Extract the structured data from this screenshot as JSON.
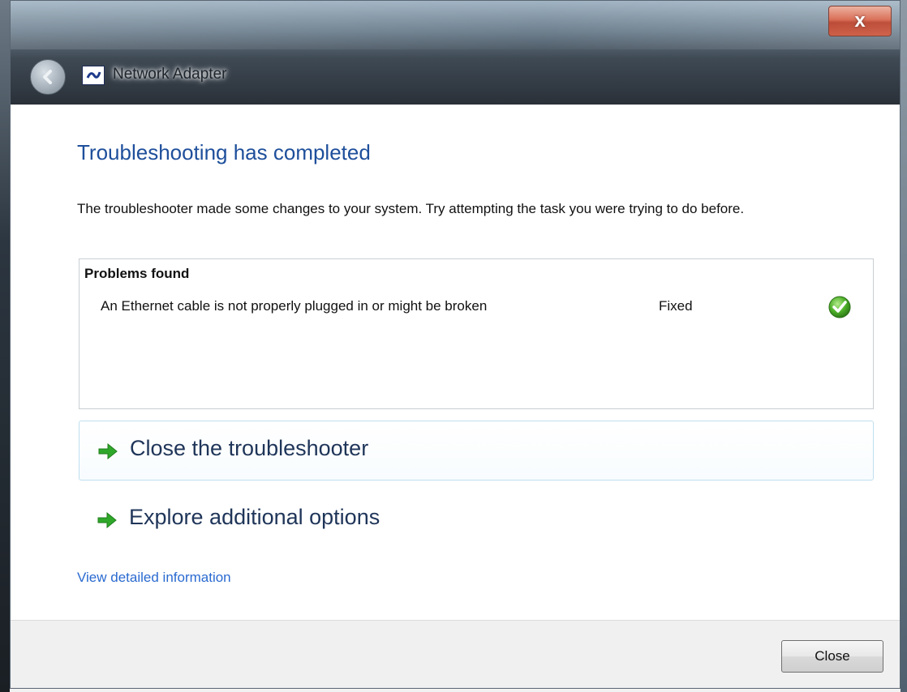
{
  "window": {
    "title": "Network Adapter",
    "close_glyph": "x"
  },
  "main": {
    "heading": "Troubleshooting has completed",
    "description": "The troubleshooter made some changes to your system. Try attempting the task you were trying to do before.",
    "problems": {
      "header": "Problems found",
      "items": [
        {
          "text": "An Ethernet cable is not properly plugged in or might be broken",
          "status": "Fixed",
          "status_icon": "green-check-icon"
        }
      ]
    },
    "options": [
      {
        "label": "Close the troubleshooter",
        "icon": "green-arrow-icon"
      },
      {
        "label": "Explore additional options",
        "icon": "green-arrow-icon"
      }
    ],
    "details_link": "View detailed information"
  },
  "footer": {
    "close_label": "Close"
  },
  "colors": {
    "heading": "#1e4f9b",
    "link": "#2a6ad0",
    "check": "#4caf27",
    "arrow": "#2fa82a"
  }
}
